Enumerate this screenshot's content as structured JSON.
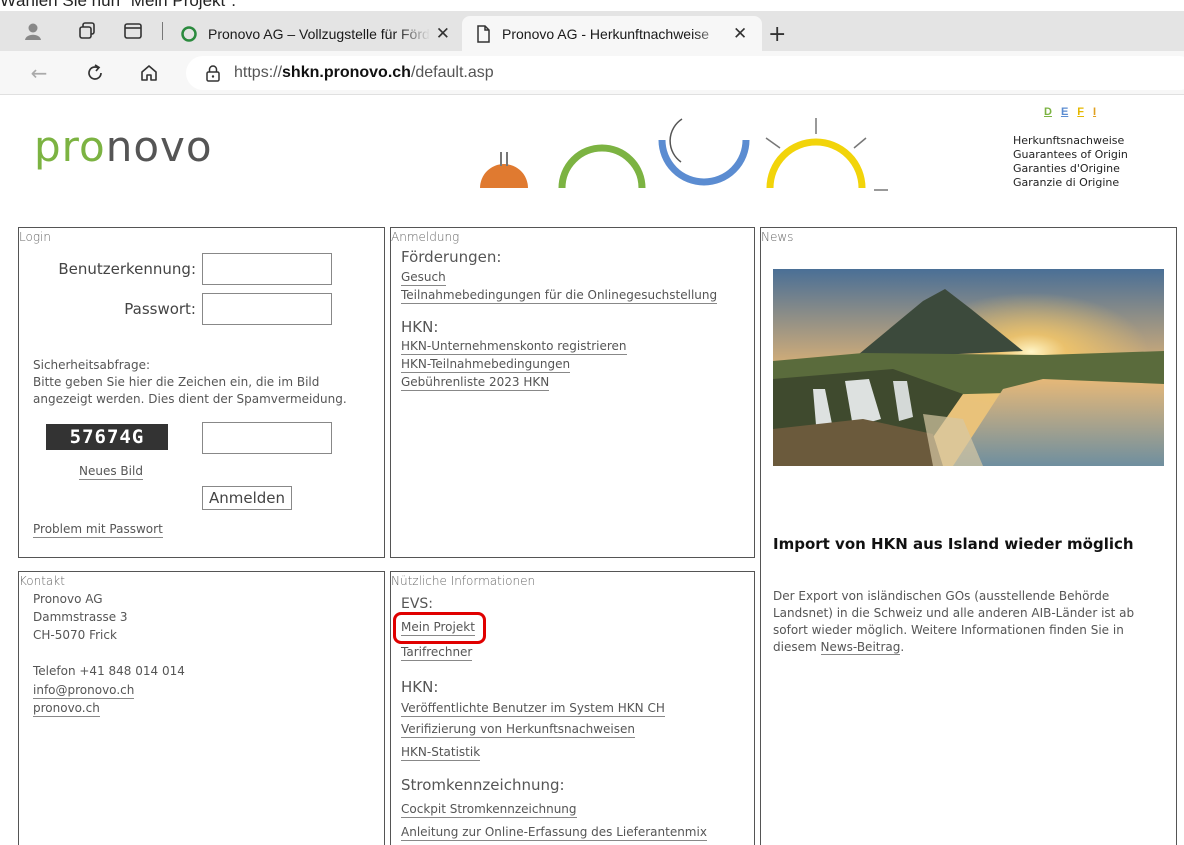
{
  "instruction": "Wählen Sie nun \"Mein Projekt\".",
  "browser": {
    "tabs": [
      {
        "title": "Pronovo AG – Vollzugstelle für Förderprogramme",
        "active": false
      },
      {
        "title": "Pronovo AG - Herkunftnachweise",
        "active": true
      }
    ],
    "url_prefix": "https://",
    "url_host": "shkn.pronovo.ch",
    "url_path": "/default.asp"
  },
  "header": {
    "logo_pro": "pro",
    "logo_novo": "novo",
    "langs": [
      "D",
      "E",
      "F",
      "I"
    ],
    "titles": [
      "Herkunftsnachweise",
      "Guarantees of Origin",
      "Garanties d'Origine",
      "Garanzie di Origine"
    ]
  },
  "login": {
    "heading": "Login",
    "user_label": "Benutzerkennung:",
    "pass_label": "Passwort:",
    "security_title": "Sicherheitsabfrage:",
    "security_text_1": "Bitte geben Sie hier die Zeichen ein, die im Bild",
    "security_text_2": "angezeigt werden. Dies dient der Spamvermeidung.",
    "captcha": "57674G",
    "new_image": "Neues Bild",
    "submit": "Anmelden",
    "problem": "Problem mit Passwort"
  },
  "anmeldung": {
    "heading": "Anmeldung",
    "foerderungen": "Förderungen:",
    "gesuch": "Gesuch",
    "teilnahme": "Teilnahmebedingungen für die Onlinegesuchstellung",
    "hkn": "HKN:",
    "hkn_links": [
      "HKN-Unternehmenskonto registrieren",
      "HKN-Teilnahmebedingungen",
      "Gebührenliste 2023 HKN"
    ]
  },
  "kontakt": {
    "heading": "Kontakt",
    "lines": [
      "Pronovo AG",
      "Dammstrasse 3",
      "CH-5070 Frick"
    ],
    "phone": "Telefon +41 848 014 014",
    "email": "info@pronovo.ch",
    "web": "pronovo.ch"
  },
  "info": {
    "heading": "Nützliche Informationen",
    "evs": "EVS:",
    "evs_links": [
      "Mein Projekt",
      "Tarifrechner"
    ],
    "hkn": "HKN:",
    "hkn_links": [
      "Veröffentlichte Benutzer im System HKN CH",
      "Verifizierung von Herkunftsnachweisen",
      "HKN-Statistik"
    ],
    "strom": "Stromkennzeichnung:",
    "strom_links": [
      "Cockpit Stromkennzeichnung",
      "Anleitung zur Online-Erfassung des Lieferantenmix"
    ]
  },
  "news": {
    "heading": "News",
    "title": "Import von HKN aus Island wieder möglich",
    "text": "Der Export von isländischen GOs (ausstellende Behörde Landsnet) in die Schweiz und alle anderen AIB-Länder ist ab sofort wieder möglich. Weitere Informationen finden Sie in diesem",
    "link": "News-Beitrag",
    "tail": "."
  },
  "colors": {
    "green": "#7cb342",
    "blue": "#5b8cd1",
    "yellow": "#f2d40a",
    "orange": "#e07a30",
    "highlight": "#e00000"
  }
}
